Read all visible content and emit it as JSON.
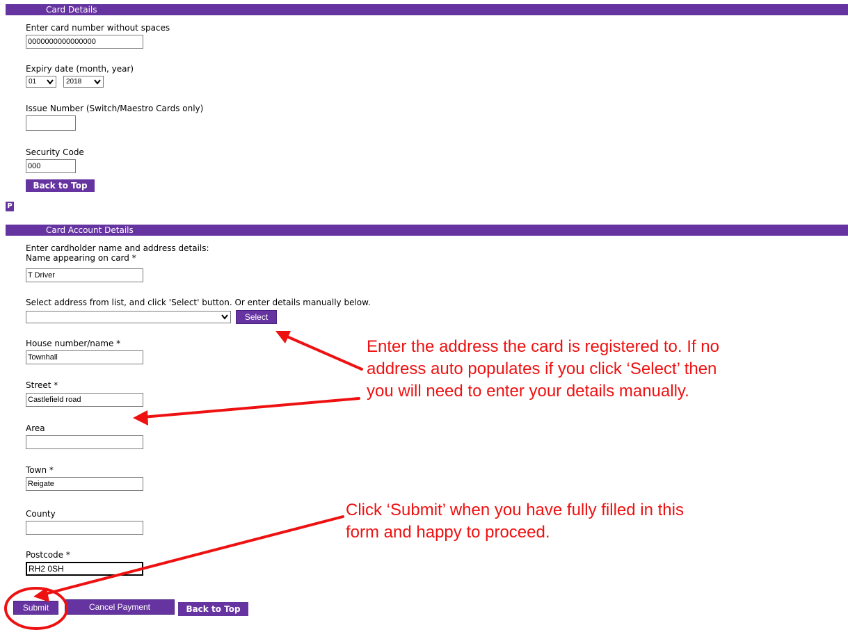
{
  "card_details": {
    "header": "Card Details",
    "card_number_label": "Enter card number without spaces",
    "card_number_value": "0000000000000000",
    "expiry_label": "Expiry date (month, year)",
    "expiry_month": "01",
    "expiry_year": "2018",
    "issue_number_label": "Issue Number (Switch/Maestro Cards only)",
    "issue_number_value": "",
    "security_code_label": "Security Code",
    "security_code_value": "000",
    "back_to_top": "Back to Top"
  },
  "separator_badge": "P",
  "account_details": {
    "header": "Card Account Details",
    "intro": "Enter cardholder name and address details:",
    "name_label": "Name appearing on card *",
    "name_value": "T Driver",
    "address_select_label": "Select address from list, and click 'Select' button. Or enter details manually below.",
    "address_select_value": "",
    "select_button": "Select",
    "house_label": "House number/name *",
    "house_value": "Townhall",
    "street_label": "Street *",
    "street_value": "Castlefield road",
    "area_label": "Area",
    "area_value": "",
    "town_label": "Town *",
    "town_value": "Reigate",
    "county_label": "County",
    "county_value": "",
    "postcode_label": "Postcode *",
    "postcode_value": "RH2 0SH"
  },
  "actions": {
    "submit": "Submit",
    "cancel_payment": "Cancel Payment",
    "back_to_top": "Back to Top"
  },
  "annotations": {
    "address_note": "Enter the address the card is registered to. If no address auto populates if you click ‘Select’ then you will need to enter your details manually.",
    "submit_note": "Click ‘Submit’ when you have fully filled in this form and happy to proceed.",
    "color": "#ee1111"
  },
  "colors": {
    "brand_purple": "#6634a0"
  },
  "icons": {
    "dropdown": "chevron-down-icon"
  }
}
